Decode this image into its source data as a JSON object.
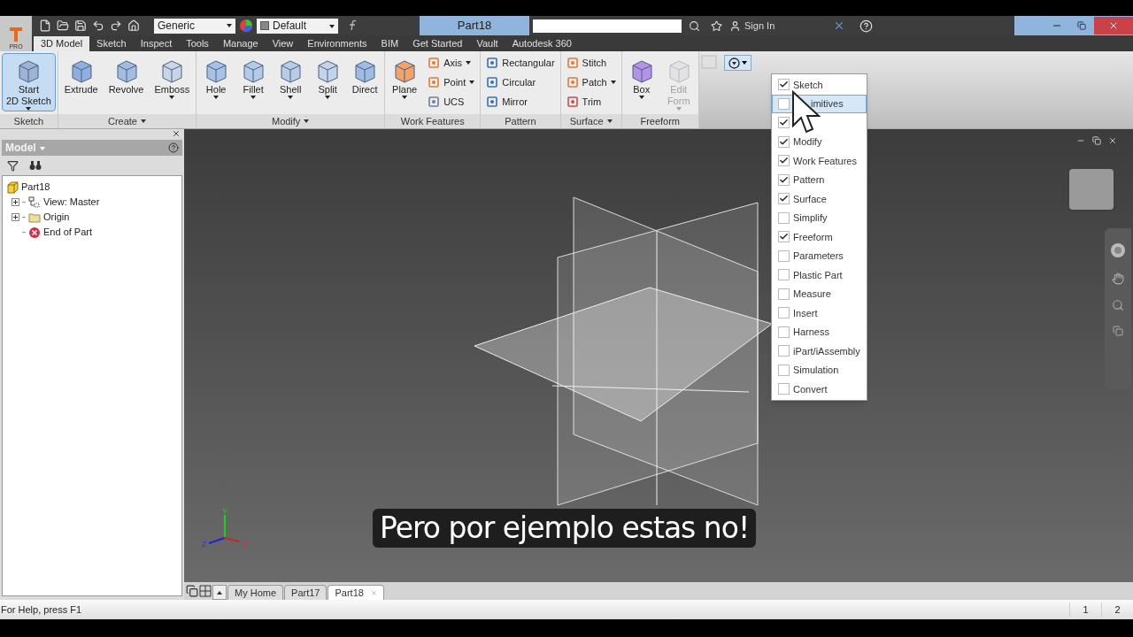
{
  "title_bar": {
    "app_badge": "PRO",
    "material": "Generic",
    "appearance": "Default",
    "document_title": "Part18",
    "sign_in": "Sign In"
  },
  "ribbon_tabs": [
    {
      "label": "3D Model",
      "selected": true
    },
    {
      "label": "Sketch",
      "selected": false
    },
    {
      "label": "Inspect",
      "selected": false
    },
    {
      "label": "Tools",
      "selected": false
    },
    {
      "label": "Manage",
      "selected": false
    },
    {
      "label": "View",
      "selected": false
    },
    {
      "label": "Environments",
      "selected": false
    },
    {
      "label": "BIM",
      "selected": false
    },
    {
      "label": "Get Started",
      "selected": false
    },
    {
      "label": "Vault",
      "selected": false
    },
    {
      "label": "Autodesk 360",
      "selected": false
    }
  ],
  "ribbon_panels": [
    {
      "title": "Sketch",
      "has_menu": false,
      "columns": [
        [
          {
            "kind": "large",
            "label": "Start\n2D Sketch",
            "dropdown": true,
            "active": true,
            "disabled": false
          }
        ]
      ]
    },
    {
      "title": "Create",
      "has_menu": true,
      "columns": [
        [
          {
            "kind": "large",
            "label": "Extrude",
            "dropdown": false,
            "active": false,
            "disabled": false
          }
        ],
        [
          {
            "kind": "large",
            "label": "Revolve",
            "dropdown": false,
            "active": false,
            "disabled": false
          }
        ],
        [
          {
            "kind": "large",
            "label": "Emboss",
            "dropdown": true,
            "active": false,
            "disabled": false
          }
        ]
      ]
    },
    {
      "title": "Modify",
      "has_menu": true,
      "columns": [
        [
          {
            "kind": "large",
            "label": "Hole",
            "dropdown": true,
            "active": false,
            "disabled": false
          }
        ],
        [
          {
            "kind": "large",
            "label": "Fillet",
            "dropdown": true,
            "active": false,
            "disabled": false
          }
        ],
        [
          {
            "kind": "large",
            "label": "Shell",
            "dropdown": true,
            "active": false,
            "disabled": false
          }
        ],
        [
          {
            "kind": "large",
            "label": "Split",
            "dropdown": true,
            "active": false,
            "disabled": false
          }
        ],
        [
          {
            "kind": "large",
            "label": "Direct",
            "dropdown": false,
            "active": false,
            "disabled": false
          }
        ]
      ]
    },
    {
      "title": "Work Features",
      "has_menu": false,
      "columns": [
        [
          {
            "kind": "large",
            "label": "Plane",
            "dropdown": true,
            "active": false,
            "disabled": false
          }
        ],
        [
          {
            "kind": "small",
            "label": "Axis",
            "dropdown": true,
            "active": false,
            "disabled": false
          },
          {
            "kind": "small",
            "label": "Point",
            "dropdown": true,
            "active": false,
            "disabled": false
          },
          {
            "kind": "small",
            "label": "UCS",
            "dropdown": false,
            "active": false,
            "disabled": false
          }
        ]
      ]
    },
    {
      "title": "Pattern",
      "has_menu": false,
      "columns": [
        [
          {
            "kind": "small",
            "label": "Rectangular",
            "dropdown": false,
            "active": false,
            "disabled": false
          },
          {
            "kind": "small",
            "label": "Circular",
            "dropdown": false,
            "active": false,
            "disabled": false
          },
          {
            "kind": "small",
            "label": "Mirror",
            "dropdown": false,
            "active": false,
            "disabled": false
          }
        ]
      ]
    },
    {
      "title": "Surface",
      "has_menu": true,
      "columns": [
        [
          {
            "kind": "small",
            "label": "Stitch",
            "dropdown": false,
            "active": false,
            "disabled": false
          },
          {
            "kind": "small",
            "label": "Patch",
            "dropdown": true,
            "active": false,
            "disabled": false
          },
          {
            "kind": "small",
            "label": "Trim",
            "dropdown": false,
            "active": false,
            "disabled": false
          }
        ]
      ]
    },
    {
      "title": "Freeform",
      "has_menu": false,
      "columns": [
        [
          {
            "kind": "large",
            "label": "Box",
            "dropdown": true,
            "active": false,
            "disabled": false
          }
        ],
        [
          {
            "kind": "large",
            "label": "Edit\nForm",
            "dropdown": true,
            "active": false,
            "disabled": true
          }
        ]
      ]
    }
  ],
  "panel_menu": {
    "items": [
      {
        "label": "Sketch",
        "checked": true,
        "selected": false
      },
      {
        "label": "imitives",
        "checked": false,
        "selected": true
      },
      {
        "checked": true,
        "selected": false
      },
      {
        "label": "Modify",
        "checked": true,
        "selected": false
      },
      {
        "label": "Work Features",
        "checked": true,
        "selected": false
      },
      {
        "label": "Pattern",
        "checked": true,
        "selected": false
      },
      {
        "label": "Surface",
        "checked": true,
        "selected": false
      },
      {
        "label": "Simplify",
        "checked": false,
        "selected": false
      },
      {
        "label": "Freeform",
        "checked": true,
        "selected": false
      },
      {
        "label": "Parameters",
        "checked": false,
        "selected": false
      },
      {
        "label": "Plastic Part",
        "checked": false,
        "selected": false
      },
      {
        "label": "Measure",
        "checked": false,
        "selected": false
      },
      {
        "label": "Insert",
        "checked": false,
        "selected": false
      },
      {
        "label": "Harness",
        "checked": false,
        "selected": false
      },
      {
        "label": "iPart/iAssembly",
        "checked": false,
        "selected": false
      },
      {
        "label": "Simulation",
        "checked": false,
        "selected": false
      },
      {
        "label": "Convert",
        "checked": false,
        "selected": false
      }
    ]
  },
  "browser": {
    "title": "Model",
    "tree": [
      {
        "label": "Part18",
        "kind": "part",
        "expandable": false,
        "children": [
          {
            "label": "View: Master",
            "kind": "view",
            "expandable": true
          },
          {
            "label": "Origin",
            "kind": "folder",
            "expandable": true
          },
          {
            "label": "End of Part",
            "kind": "end",
            "expandable": false
          }
        ]
      }
    ]
  },
  "viewport": {
    "triad": {
      "y": "Y",
      "z": "Z",
      "x": "X"
    },
    "subtitle": "Pero por ejemplo estas no!"
  },
  "document_tabs": [
    {
      "label": "My Home",
      "selected": false
    },
    {
      "label": "Part17",
      "selected": false
    },
    {
      "label": "Part18",
      "selected": true
    }
  ],
  "status_bar": {
    "help": "For Help, press F1",
    "field_1": "1",
    "field_2": "2"
  }
}
